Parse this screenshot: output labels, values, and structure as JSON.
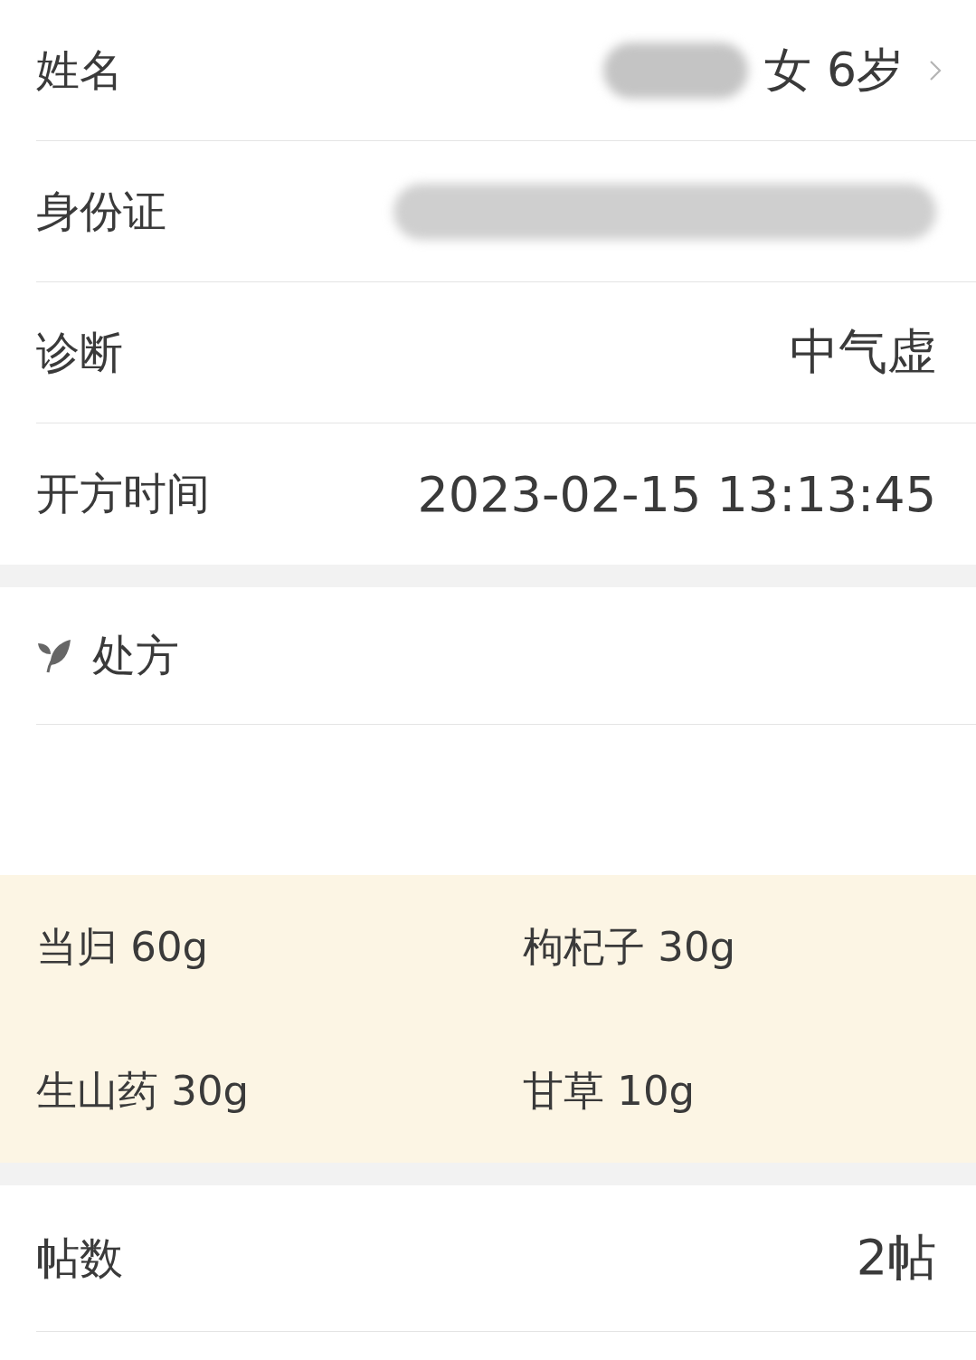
{
  "info_rows": [
    {
      "label": "姓名",
      "value": "女 6岁",
      "blurred": true,
      "arrow": true
    },
    {
      "label": "身份证",
      "blurred": true,
      "arrow": false
    },
    {
      "label": "诊断",
      "value": "中气虚",
      "blurred": false,
      "arrow": false
    },
    {
      "label": "开方时间",
      "value": "2023-02-15 13:13:45",
      "blurred": false,
      "arrow": false
    }
  ],
  "prescription": {
    "title": "处方",
    "herbs": [
      "当归 60g",
      "枸杞子 30g",
      "生山药 30g",
      "甘草 10g"
    ]
  },
  "dose_row": {
    "label": "帖数",
    "value": "2帖"
  }
}
